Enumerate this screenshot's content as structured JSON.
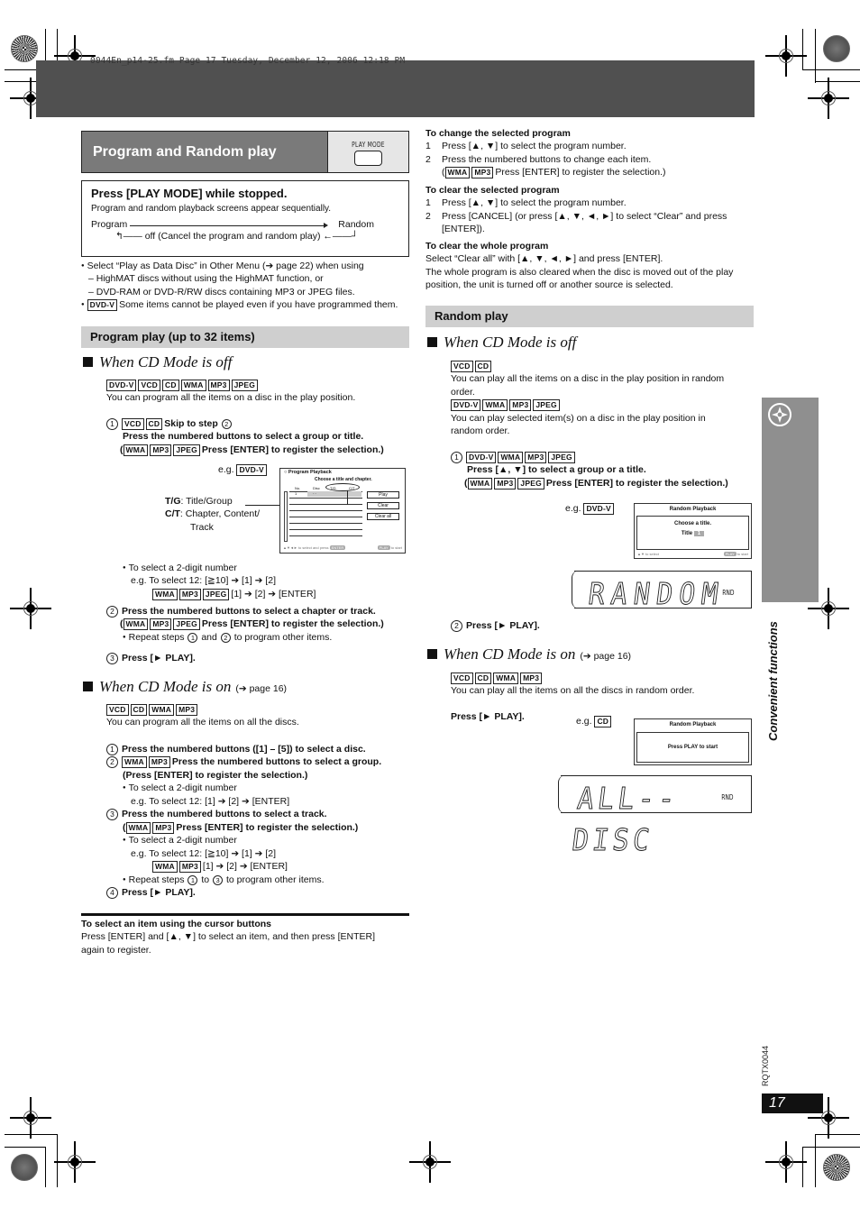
{
  "file_header": "0044En_p14-25.fm  Page 17  Tuesday, December 12, 2006  12:18 PM",
  "title": "Program and Random play",
  "play_mode_button_label": "PLAY MODE",
  "press_box": {
    "heading": "Press [PLAY MODE] while stopped.",
    "desc": "Program and random playback screens appear sequentially.",
    "flow_program": "Program",
    "flow_random": "Random",
    "flow_off": "off (Cancel the program and random play)"
  },
  "notes": {
    "n1": "Select “Play as Data Disc” in Other Menu (➔ page 22) when using",
    "n1a": "– HighMAT discs without using the HighMAT function, or",
    "n1b": "– DVD-RAM or DVD-R/RW discs containing MP3 or JPEG files.",
    "n2_tag": "DVD-V",
    "n2": "Some items cannot be played even if you have programmed them."
  },
  "program": {
    "section_title": "Program play (up to 32 items)",
    "off": {
      "heading": "When CD Mode is off",
      "tags": [
        "DVD-V",
        "VCD",
        "CD",
        "WMA",
        "MP3",
        "JPEG"
      ],
      "desc": "You can program all the items on a disc in the play position.",
      "s1_num": "1",
      "s1_tags": [
        "VCD",
        "CD"
      ],
      "s1_skip": "Skip to step",
      "s1_skip_num": "2",
      "s1_text": "Press the numbered buttons to select a group or title.",
      "s1_sub_tags": [
        "WMA",
        "MP3",
        "JPEG"
      ],
      "s1_sub": "Press [ENTER] to register the selection.)",
      "eg": "e.g.",
      "eg_tag": "DVD-V",
      "tg_key": "T/G",
      "tg_val": ": Title/Group",
      "ct_key": "C/T",
      "ct_val": ": Chapter, Content/",
      "ct_val2": "Track",
      "screen": {
        "title": "Program Playback",
        "subtitle": "Choose a title and chapter.",
        "col_no": "No.",
        "col_disc": "Disc",
        "col_tg": "T/G",
        "col_ct": "C/T",
        "row1_no": "1",
        "row1_disc": "- -",
        "btn_play": "Play",
        "btn_clear": "Clear",
        "btn_clear_all": "Clear all",
        "footer_left": "▲▼◄► to select and press",
        "footer_enter": "ENTER",
        "footer_play": "PLAY",
        "footer_right": "to start"
      },
      "two_digit": "To select a 2-digit number",
      "two_digit_eg": "e.g. To select 12: [≧10] ➔ [1] ➔ [2]",
      "two_digit_tags": [
        "WMA",
        "MP3",
        "JPEG"
      ],
      "two_digit_eg2": "[1] ➔ [2] ➔ [ENTER]",
      "s2_num": "2",
      "s2_text": "Press the numbered buttons to select a chapter or track.",
      "s2_sub_tags": [
        "WMA",
        "MP3",
        "JPEG"
      ],
      "s2_sub": "Press [ENTER] to register the selection.)",
      "repeat_a": "Repeat steps",
      "repeat_n1": "1",
      "repeat_and": "and",
      "repeat_n2": "2",
      "repeat_b": "to program other items.",
      "s3_num": "3",
      "s3_text": "Press [► PLAY]."
    },
    "on": {
      "heading": "When CD Mode is on",
      "ref": "(➔ page 16)",
      "tags": [
        "VCD",
        "CD",
        "WMA",
        "MP3"
      ],
      "desc": "You can program all the items on all the discs.",
      "s1_num": "1",
      "s1_text": "Press the numbered buttons ([1] – [5]) to select a disc.",
      "s2_num": "2",
      "s2_tags": [
        "WMA",
        "MP3"
      ],
      "s2_text": "Press the numbered buttons to select a group.",
      "s2_sub": "(Press [ENTER] to register the selection.)",
      "s2_two_digit": "To select a 2-digit number",
      "s2_two_digit_eg": "e.g. To select 12: [1] ➔ [2] ➔ [ENTER]",
      "s3_num": "3",
      "s3_text": "Press the numbered buttons to select a track.",
      "s3_sub_tags": [
        "WMA",
        "MP3"
      ],
      "s3_sub": "Press [ENTER] to register the selection.)",
      "s3_two_digit": "To select a 2-digit number",
      "s3_two_digit_eg": "e.g. To select 12: [≧10] ➔ [1] ➔ [2]",
      "s3_two_digit_tags": [
        "WMA",
        "MP3"
      ],
      "s3_two_digit_eg2": "[1] ➔ [2] ➔ [ENTER]",
      "repeat_a": "Repeat steps",
      "repeat_n1": "1",
      "repeat_to": "to",
      "repeat_n2": "3",
      "repeat_b": "to program other items.",
      "s4_num": "4",
      "s4_text": "Press [► PLAY]."
    }
  },
  "cursor": {
    "heading": "To select an item using the cursor buttons",
    "text1": "Press [ENTER] and [▲, ▼] to select an item, and then press [ENTER]",
    "text2": "again to register."
  },
  "change": {
    "heading": "To change the selected program",
    "l1_num": "1",
    "l1": "Press [▲, ▼] to select the program number.",
    "l2_num": "2",
    "l2": "Press the numbered buttons to change each item.",
    "l2_tags": [
      "WMA",
      "MP3"
    ],
    "l2_sub": "Press [ENTER] to register the selection.)"
  },
  "clear_selected": {
    "heading": "To clear the selected program",
    "l1_num": "1",
    "l1": "Press [▲, ▼] to select the program number.",
    "l2_num": "2",
    "l2": "Press [CANCEL] (or press [▲, ▼, ◄, ►] to select “Clear” and press",
    "l2b": "[ENTER])."
  },
  "clear_whole": {
    "heading": "To clear the whole program",
    "text1": "Select “Clear all” with [▲, ▼, ◄, ►] and press [ENTER].",
    "text2": "The whole program is also cleared when the disc is moved out of the play",
    "text3": "position, the unit is turned off or another source is selected."
  },
  "random": {
    "section_title": "Random play",
    "off": {
      "heading": "When CD Mode is off",
      "tags1": [
        "VCD",
        "CD"
      ],
      "desc1a": "You can play all the items on a disc in the play position in random",
      "desc1b": "order.",
      "tags2": [
        "DVD-V",
        "WMA",
        "MP3",
        "JPEG"
      ],
      "desc2a": "You can play selected item(s) on a disc in the play position in",
      "desc2b": "random order.",
      "s1_num": "1",
      "s1_tags": [
        "DVD-V",
        "WMA",
        "MP3",
        "JPEG"
      ],
      "s1_text": "Press [▲, ▼] to select a group or a title.",
      "s1_sub_tags": [
        "WMA",
        "MP3",
        "JPEG"
      ],
      "s1_sub": "Press [ENTER] to register the selection.)",
      "eg": "e.g.",
      "eg_tag": "DVD-V",
      "screen": {
        "title": "Random Playback",
        "line1": "Choose a title.",
        "title_label": "Title",
        "title_value": "1",
        "footer_left": "▲▼ to select",
        "footer_play": "PLAY",
        "footer_right": "to start"
      },
      "display_text": "RANDOM",
      "display_indicator": "RND",
      "s2_num": "2",
      "s2_text": "Press [► PLAY]."
    },
    "on": {
      "heading": "When CD Mode is on",
      "ref": "(➔ page 16)",
      "tags": [
        "VCD",
        "CD",
        "WMA",
        "MP3"
      ],
      "desc": "You can play all the items on all the discs in random order.",
      "press": "Press [► PLAY].",
      "eg": "e.g.",
      "eg_tag": "CD",
      "screen": {
        "title": "Random Playback",
        "line1": "Press PLAY to start"
      },
      "display_text": "ALL--DISC",
      "display_indicator": "RND"
    }
  },
  "side_label": "Convenient functions",
  "model_code": "RQTX0044",
  "page_number": "17"
}
